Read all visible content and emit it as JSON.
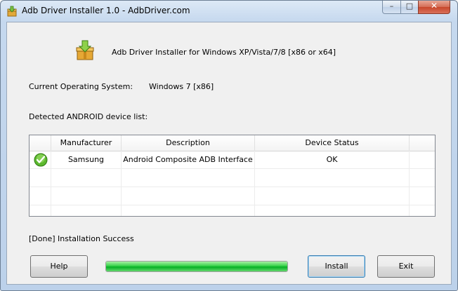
{
  "window": {
    "title": "Adb Driver Installer 1.0  -  AdbDriver.com",
    "controls": {
      "minimize": "–",
      "maximize": "□",
      "close": "✕"
    }
  },
  "header": {
    "tagline": "Adb Driver Installer for Windows XP/Vista/7/8 [x86 or x64]",
    "logo_icon": "package-download-icon"
  },
  "os": {
    "label": "Current Operating System:",
    "value": "Windows 7  [x86]"
  },
  "devices": {
    "label": "Detected ANDROID device list:",
    "columns": [
      "",
      "Manufacturer",
      "Description",
      "Device Status"
    ],
    "rows": [
      {
        "status_icon": "check-icon",
        "manufacturer": "Samsung",
        "description": "Android Composite ADB Interface",
        "status": "OK"
      }
    ]
  },
  "status_text": "[Done] Installation Success",
  "progress": {
    "value": 1.0,
    "color": "#06b025"
  },
  "buttons": {
    "help": "Help",
    "install": "Install",
    "exit": "Exit"
  }
}
